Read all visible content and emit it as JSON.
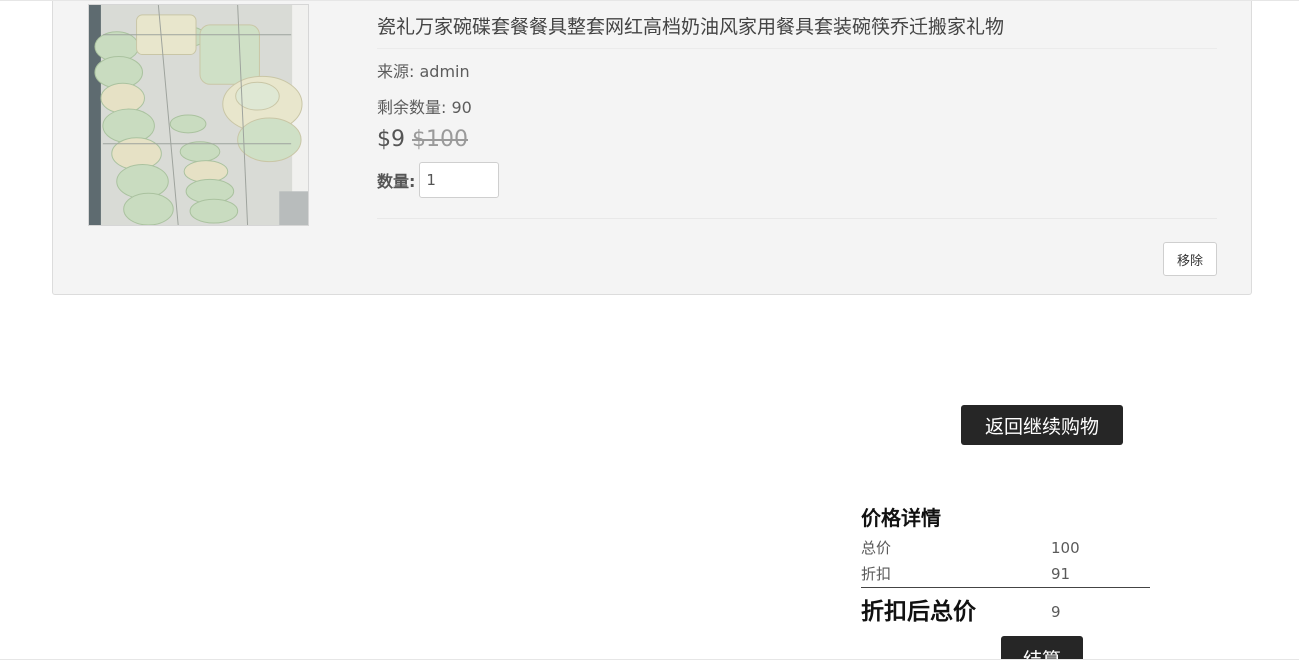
{
  "product": {
    "title": "瓷礼万家碗碟套餐餐具整套网红高档奶油风家用餐具套装碗筷乔迁搬家礼物",
    "source": "来源: admin",
    "stock": "剩余数量: 90",
    "price": "$9",
    "original_price": "$100",
    "quantity_label": "数量:",
    "quantity_value": "1",
    "remove_label": "移除"
  },
  "continue_label": "返回继续购物",
  "summary": {
    "title": "价格详情",
    "total_label": "总价",
    "total_value": "100",
    "discount_label": "折扣",
    "discount_value": "91",
    "final_label": "折扣后总价",
    "final_value": "9",
    "checkout_label": "结算"
  },
  "colors": {
    "card_bg": "#f4f4f4",
    "button_dark": "#262626",
    "image_bg": "#e9e9e9"
  }
}
